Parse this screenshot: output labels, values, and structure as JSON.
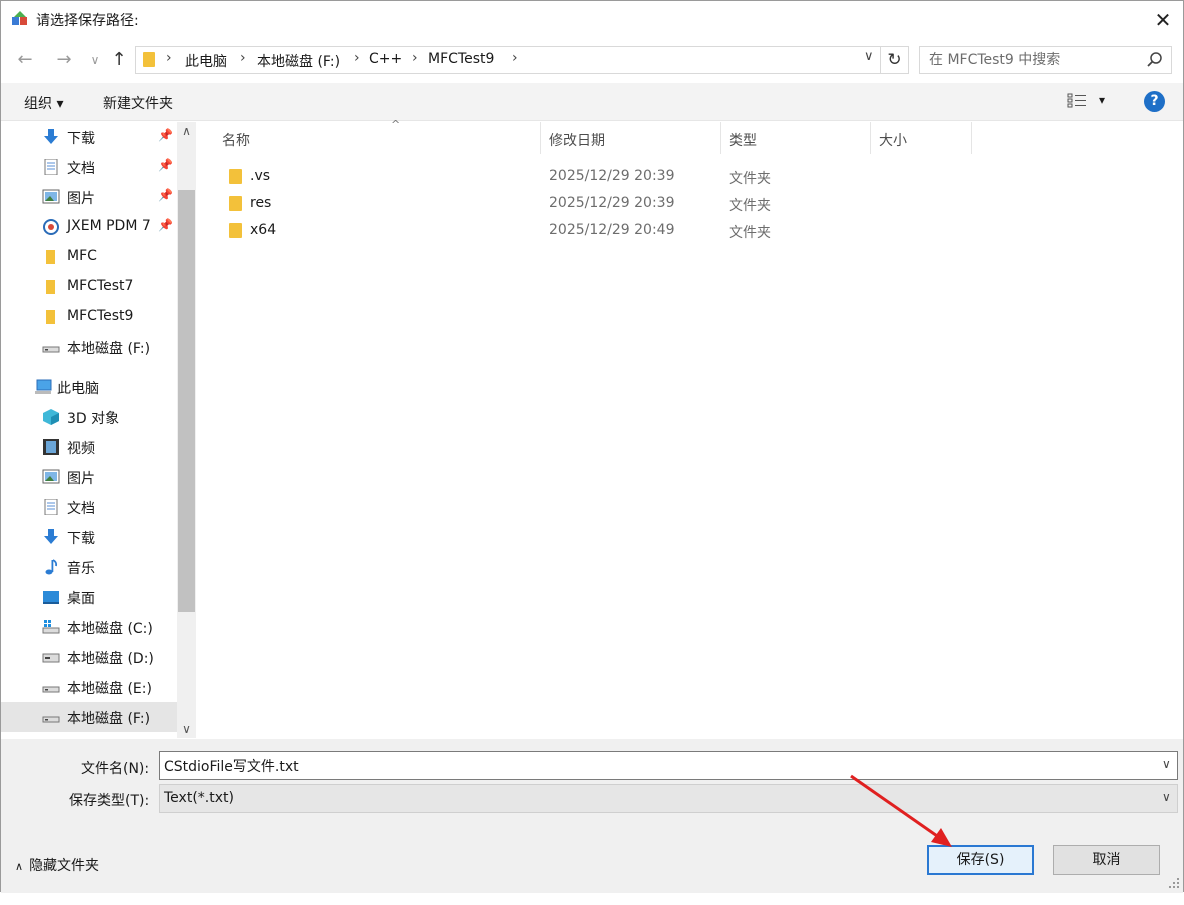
{
  "window": {
    "title": "请选择保存路径:",
    "close_glyph": "✕"
  },
  "nav": {
    "back_glyph": "←",
    "forward_glyph": "→",
    "recent_glyph": "∨",
    "up_glyph": "↑",
    "breadcrumbs": [
      "此电脑",
      "本地磁盘 (F:)",
      "C++",
      "MFCTest9"
    ],
    "separator": "›",
    "dropdown_glyph": "∨",
    "refresh_glyph": "↻",
    "search_placeholder": "在 MFCTest9 中搜索"
  },
  "toolbar": {
    "organize_label": "组织 ▾",
    "new_folder_label": "新建文件夹",
    "view_dropdown": "▾",
    "help_label": "?"
  },
  "sidebar": {
    "quick_access": [
      {
        "label": "下载",
        "icon": "download-arrow-icon",
        "pinned": true
      },
      {
        "label": "文档",
        "icon": "document-icon",
        "pinned": true
      },
      {
        "label": "图片",
        "icon": "picture-icon",
        "pinned": true
      },
      {
        "label": "JXEM PDM 7",
        "icon": "pdm-icon",
        "pinned": true
      },
      {
        "label": "MFC",
        "icon": "folder-icon",
        "pinned": false
      },
      {
        "label": "MFCTest7",
        "icon": "folder-icon",
        "pinned": false
      },
      {
        "label": "MFCTest9",
        "icon": "folder-icon",
        "pinned": false
      },
      {
        "label": "本地磁盘 (F:)",
        "icon": "drive-icon",
        "pinned": false
      }
    ],
    "this_pc_label": "此电脑",
    "this_pc_items": [
      {
        "label": "3D 对象",
        "icon": "3d-objects-icon"
      },
      {
        "label": "视频",
        "icon": "video-icon"
      },
      {
        "label": "图片",
        "icon": "picture-icon"
      },
      {
        "label": "文档",
        "icon": "document-icon"
      },
      {
        "label": "下载",
        "icon": "download-arrow-icon"
      },
      {
        "label": "音乐",
        "icon": "music-icon"
      },
      {
        "label": "桌面",
        "icon": "desktop-icon"
      },
      {
        "label": "本地磁盘 (C:)",
        "icon": "windows-drive-icon"
      },
      {
        "label": "本地磁盘 (D:)",
        "icon": "drive-icon"
      },
      {
        "label": "本地磁盘 (E:)",
        "icon": "drive-icon"
      },
      {
        "label": "本地磁盘 (F:)",
        "icon": "drive-icon",
        "selected": true
      }
    ],
    "pin_glyph": "📌",
    "scroll_up": "∧",
    "scroll_down": "∨"
  },
  "filelist": {
    "sort_caret": "^",
    "columns": [
      "名称",
      "修改日期",
      "类型",
      "大小"
    ],
    "rows": [
      {
        "name": ".vs",
        "date": "2025/12/29 20:39",
        "type": "文件夹"
      },
      {
        "name": "res",
        "date": "2025/12/29 20:39",
        "type": "文件夹"
      },
      {
        "name": "x64",
        "date": "2025/12/29 20:49",
        "type": "文件夹"
      }
    ]
  },
  "bottom": {
    "filename_label": "文件名(N):",
    "filename_value": "CStdioFile写文件.txt",
    "filetype_label": "保存类型(T):",
    "filetype_value": "Text(*.txt)",
    "dropdown_glyph": "∨",
    "hide_folders_caret": "∧",
    "hide_folders_label": "隐藏文件夹",
    "save_label": "保存(S)",
    "cancel_label": "取消"
  },
  "colors": {
    "accent": "#2a78d2",
    "folder": "#f3c13a",
    "annotation_arrow": "#e02020"
  }
}
